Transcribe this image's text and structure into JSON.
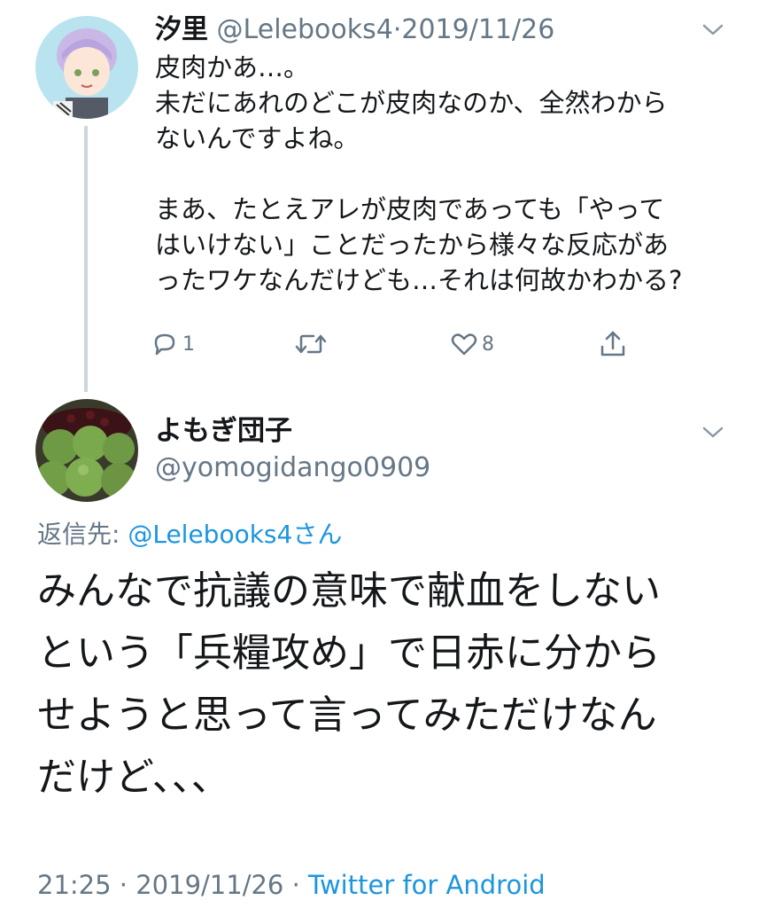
{
  "tweet1": {
    "display_name": "汐里",
    "handle": "@Lelebooks4",
    "separator": "·",
    "date": "2019/11/26",
    "text": "皮肉かあ…。\n未だにあれのどこが皮肉なのか、全然わから\nないんですよね。\n\nまあ、たとえアレが皮肉であっても「やって\nはいけない」ことだったから様々な反応があ\nったワケなんだけども…それは何故かわかる?",
    "reply_count": "1",
    "retweet_count": "",
    "like_count": "8"
  },
  "tweet2": {
    "display_name": "よもぎ団子",
    "handle": "@yomogidango0909",
    "reply_to_label": "返信先: ",
    "reply_to_mention": "@Lelebooks4さん",
    "text": "みんなで抗議の意味で献血をしない\nという「兵糧攻め」で日赤に分から\nせようと思って言ってみただけなん\nだけど、、、",
    "time": "21:25",
    "separator": "·",
    "date": "2019/11/26",
    "source_separator": "·",
    "source": "Twitter for Android"
  },
  "icons": {
    "reply": "reply-icon",
    "retweet": "retweet-icon",
    "like": "heart-icon",
    "share": "share-icon",
    "menu": "chevron-down-icon"
  },
  "colors": {
    "text_primary": "#14171a",
    "text_secondary": "#657786",
    "link": "#1b95e0",
    "thread_line": "#ccd6dd"
  }
}
